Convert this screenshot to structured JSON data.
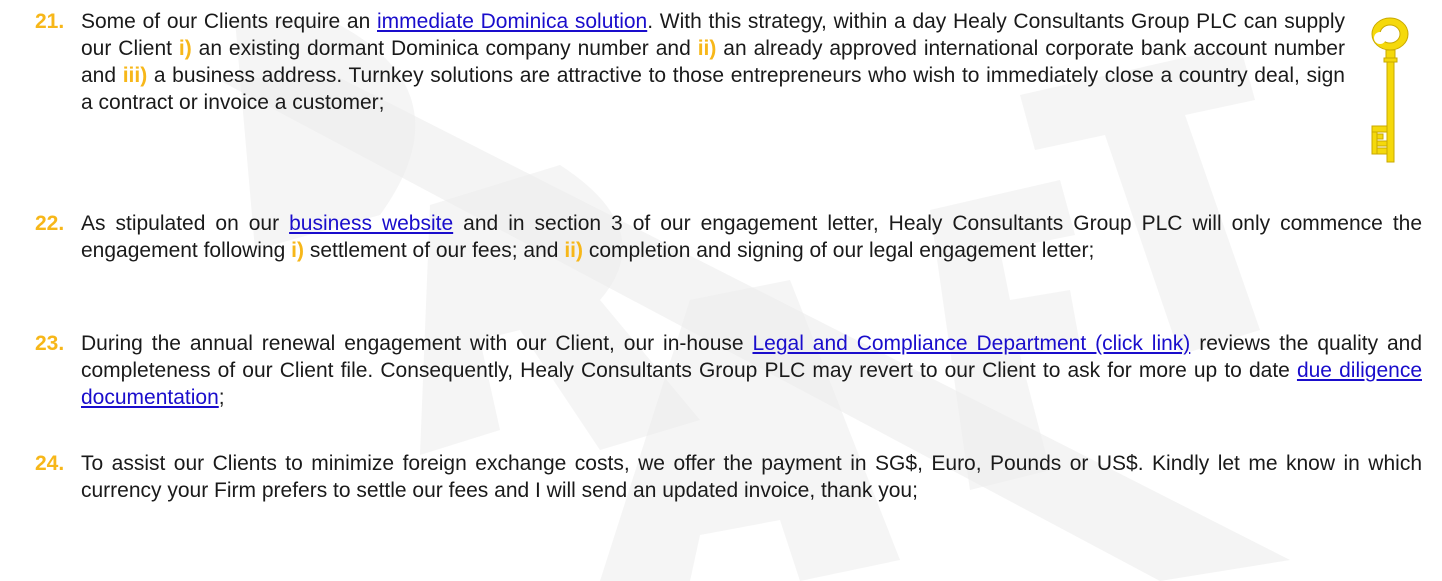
{
  "colors": {
    "accent": "#f7b719",
    "link": "#1a0dcc",
    "text": "#1a1a1a",
    "watermark": "#e8e8e8"
  },
  "watermark_text": "DRAFT",
  "key_icon": "golden-key-icon",
  "items": [
    {
      "number": "21.",
      "text": {
        "p1": "Some of our Clients require an ",
        "link1": "immediate Dominica solution",
        "p2": ". With this strategy, within a day Healy Consultants Group PLC can supply our Client ",
        "m1": "i)",
        "p3": " an existing dormant Dominica company number and ",
        "m2": "ii)",
        "p4": " an already approved international corporate bank account number and ",
        "m3": "iii)",
        "p5": " a business address. Turnkey solutions are attractive to those entrepreneurs who wish to immediately close a country deal, sign a contract or invoice a customer;"
      }
    },
    {
      "number": "22.",
      "text": {
        "p1": "As stipulated on our ",
        "link1": "business website",
        "p2": " and in section 3 of our engagement letter, Healy Consultants Group PLC will only commence the engagement following ",
        "m1": "i)",
        "p3": " settlement of our fees; and ",
        "m2": "ii)",
        "p4": " completion and signing of our legal engagement letter;"
      }
    },
    {
      "number": "23.",
      "text": {
        "p1": "During the annual renewal engagement with our Client, our in-house ",
        "link1": "Legal and Compliance Department (click link)",
        "p2": " reviews the quality and completeness of our Client file. Consequently, Healy Consultants Group PLC may revert to our Client to ask for more up to date ",
        "link2": "due diligence documentation",
        "p3": ";"
      }
    },
    {
      "number": "24.",
      "text": {
        "p1": "To assist our Clients to minimize foreign exchange costs, we offer the payment in SG$, Euro, Pounds or US$. Kindly let me know in which currency your Firm prefers to settle our fees and I will send an updated invoice, thank you;"
      }
    }
  ]
}
